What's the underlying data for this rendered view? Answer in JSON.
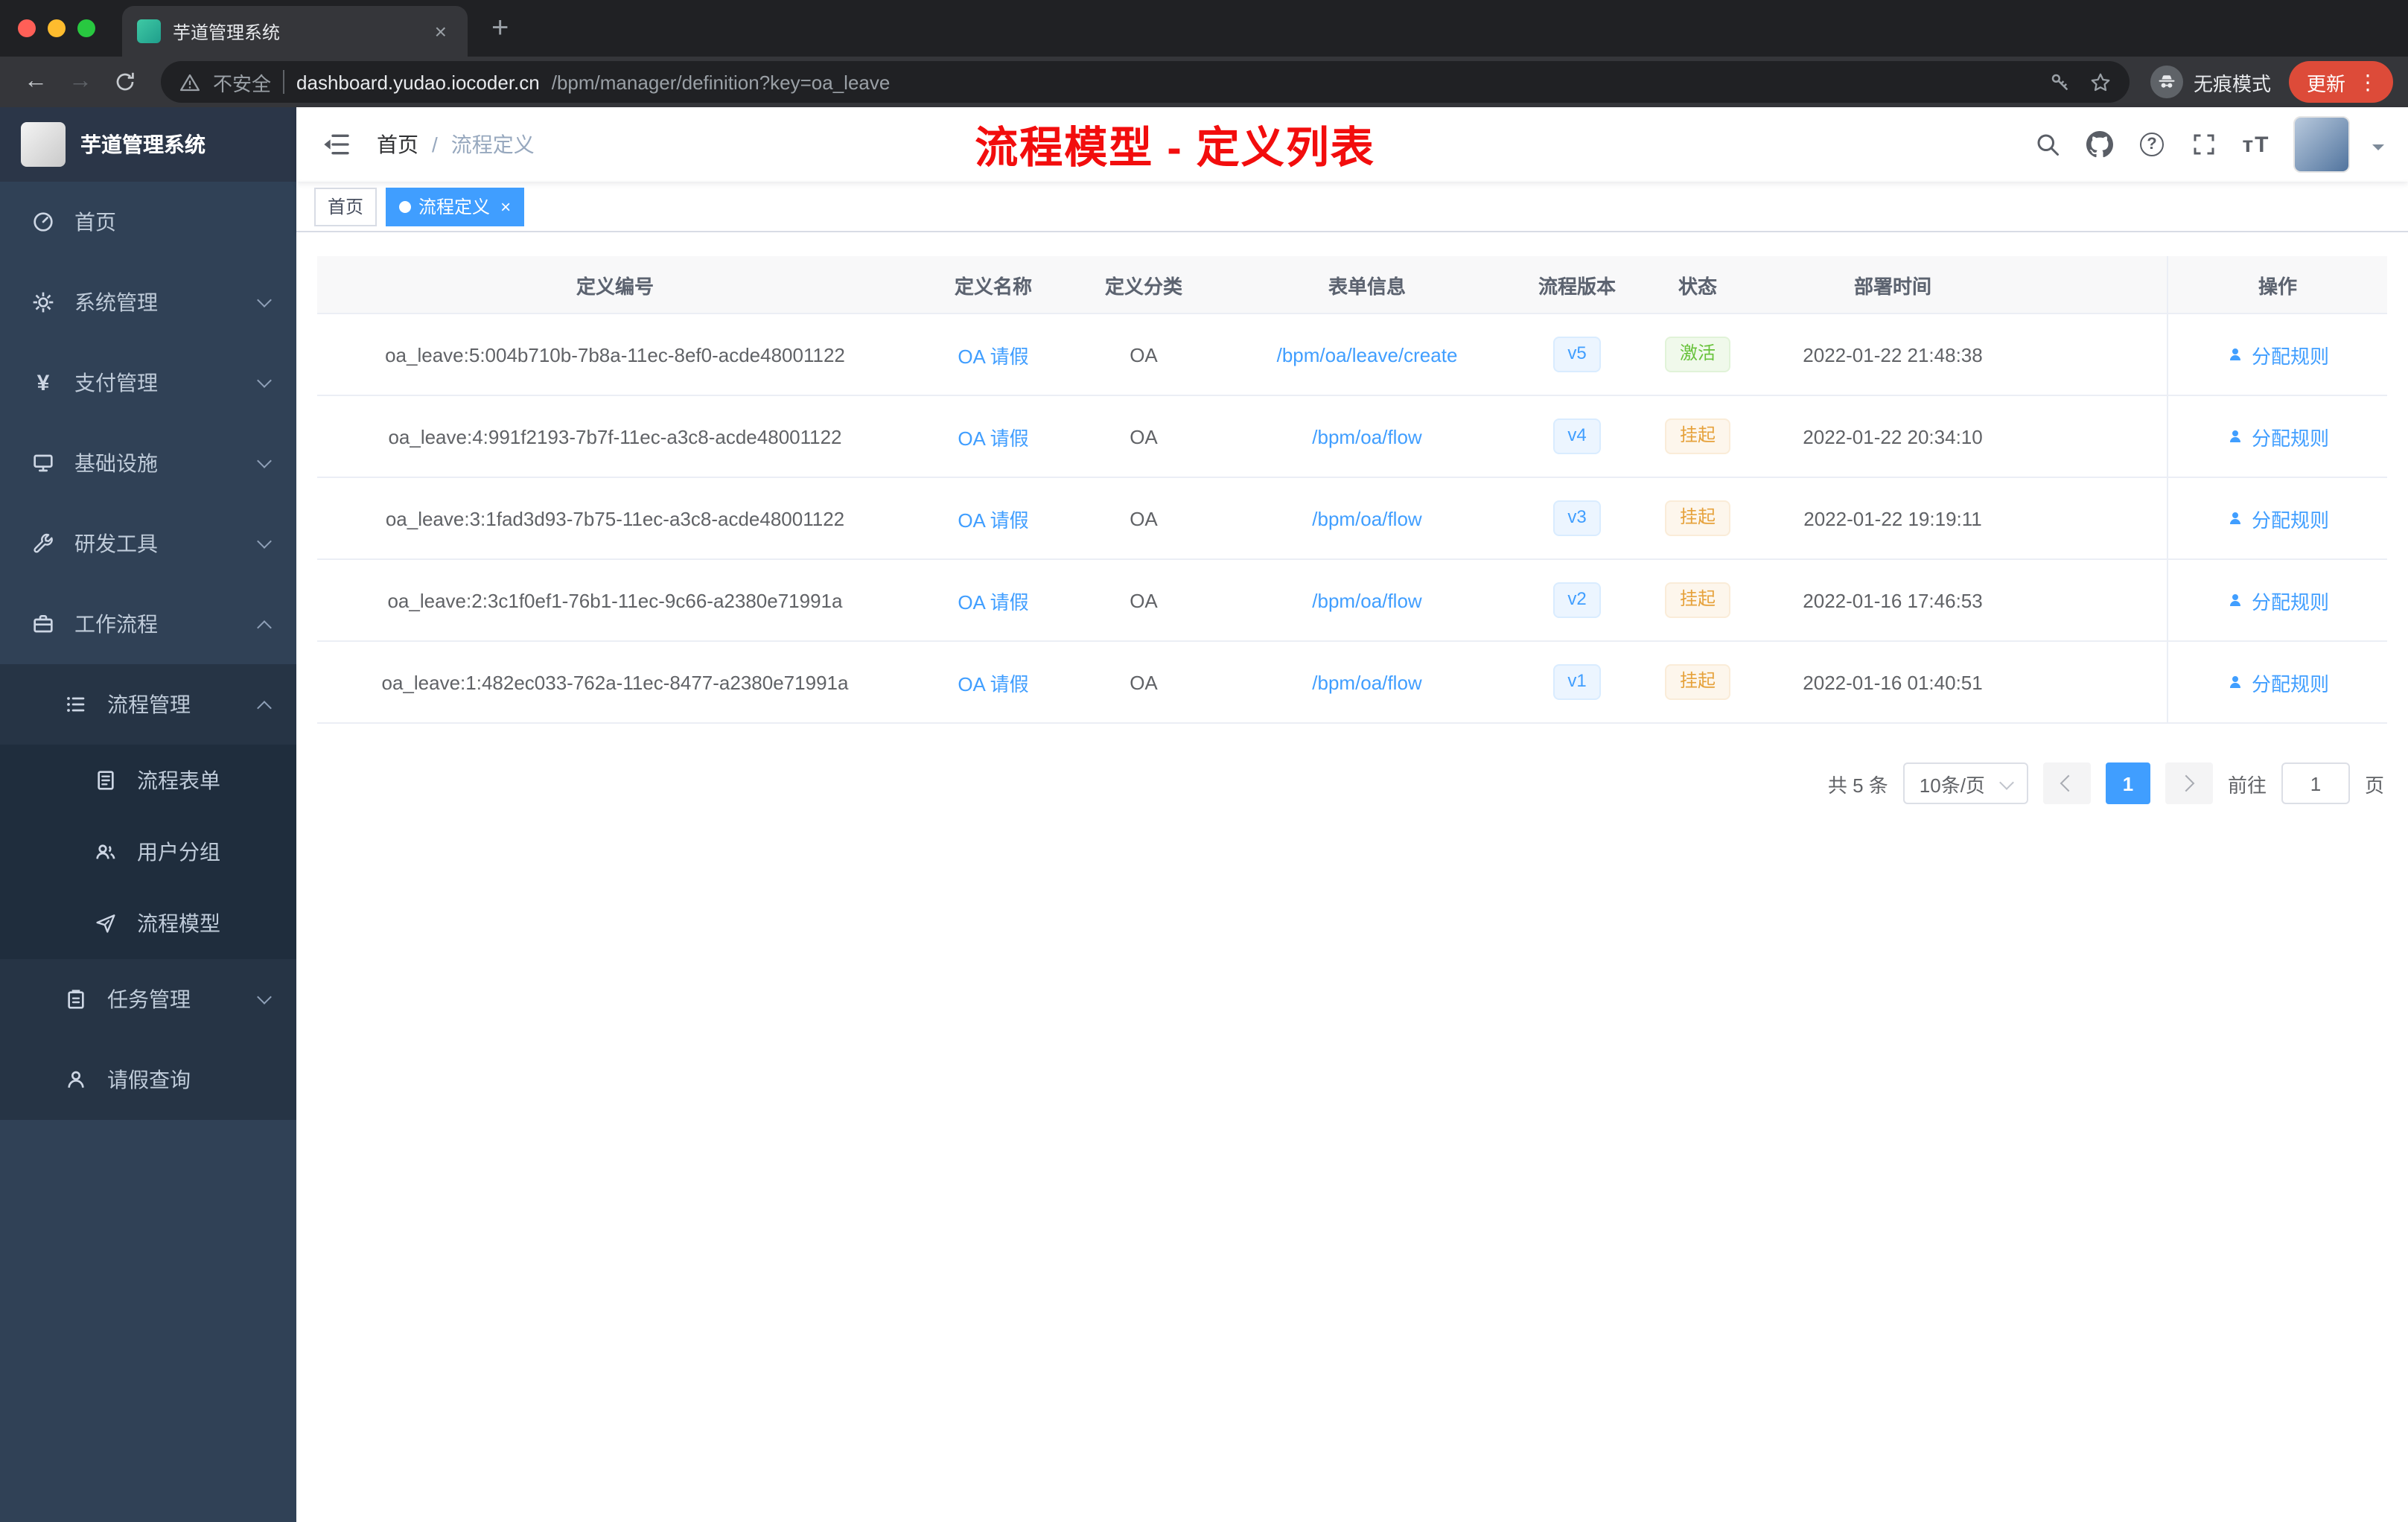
{
  "browser": {
    "tab": {
      "title": "芋道管理系统"
    },
    "address": {
      "security_label": "不安全",
      "host": "dashboard.yudao.iocoder.cn",
      "path": "/bpm/manager/definition?key=oa_leave"
    },
    "incognito_label": "无痕模式",
    "update_label": "更新"
  },
  "icons": {
    "close": "×",
    "new_tab": "+",
    "more": "⋮",
    "back": "←",
    "forward": "→",
    "question": "?",
    "font_size": "тT"
  },
  "sidebar": {
    "logo_title": "芋道管理系统",
    "items": [
      {
        "label": "首页"
      },
      {
        "label": "系统管理"
      },
      {
        "label": "支付管理"
      },
      {
        "label": "基础设施"
      },
      {
        "label": "研发工具"
      },
      {
        "label": "工作流程"
      },
      {
        "label": "流程管理"
      },
      {
        "label": "流程表单"
      },
      {
        "label": "用户分组"
      },
      {
        "label": "流程模型"
      },
      {
        "label": "任务管理"
      },
      {
        "label": "请假查询"
      }
    ]
  },
  "header": {
    "breadcrumb": {
      "home": "首页",
      "separator": "/",
      "current": "流程定义"
    },
    "annotation": "流程模型 - 定义列表"
  },
  "tags": {
    "home": "首页",
    "active": "流程定义",
    "close": "×"
  },
  "table": {
    "columns": [
      "定义编号",
      "定义名称",
      "定义分类",
      "表单信息",
      "流程版本",
      "状态",
      "部署时间",
      "操作"
    ],
    "rows": [
      {
        "id": "oa_leave:5:004b710b-7b8a-11ec-8ef0-acde48001122",
        "name": "OA 请假",
        "category": "OA",
        "form": "/bpm/oa/leave/create",
        "version": "v5",
        "status": "激活",
        "status_type": "success",
        "time": "2022-01-22 21:48:38",
        "action": "分配规则"
      },
      {
        "id": "oa_leave:4:991f2193-7b7f-11ec-a3c8-acde48001122",
        "name": "OA 请假",
        "category": "OA",
        "form": "/bpm/oa/flow",
        "version": "v4",
        "status": "挂起",
        "status_type": "warning",
        "time": "2022-01-22 20:34:10",
        "action": "分配规则"
      },
      {
        "id": "oa_leave:3:1fad3d93-7b75-11ec-a3c8-acde48001122",
        "name": "OA 请假",
        "category": "OA",
        "form": "/bpm/oa/flow",
        "version": "v3",
        "status": "挂起",
        "status_type": "warning",
        "time": "2022-01-22 19:19:11",
        "action": "分配规则"
      },
      {
        "id": "oa_leave:2:3c1f0ef1-76b1-11ec-9c66-a2380e71991a",
        "name": "OA 请假",
        "category": "OA",
        "form": "/bpm/oa/flow",
        "version": "v2",
        "status": "挂起",
        "status_type": "warning",
        "time": "2022-01-16 17:46:53",
        "action": "分配规则"
      },
      {
        "id": "oa_leave:1:482ec033-762a-11ec-8477-a2380e71991a",
        "name": "OA 请假",
        "category": "OA",
        "form": "/bpm/oa/flow",
        "version": "v1",
        "status": "挂起",
        "status_type": "warning",
        "time": "2022-01-16 01:40:51",
        "action": "分配规则"
      }
    ]
  },
  "pagination": {
    "total": "共 5 条",
    "page_size": "10条/页",
    "current_page": "1",
    "goto_label": "前往",
    "goto_value": "1",
    "page_unit": "页"
  },
  "colors": {
    "primary": "#409eff",
    "success": "#67c23a",
    "warning": "#e6a23c",
    "annotation_red": "#f20d0d",
    "sidebar_bg": "#304156",
    "submenu_bg": "#1f2d3d",
    "update_badge": "#dd4b39"
  }
}
